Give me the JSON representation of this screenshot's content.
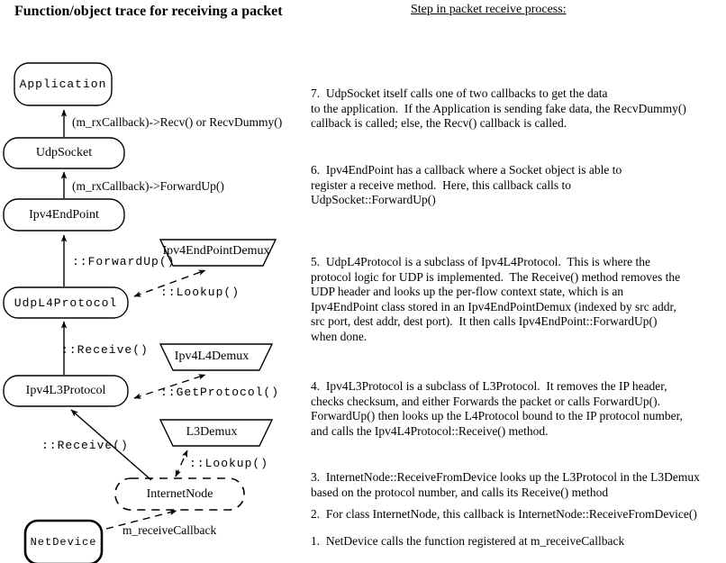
{
  "title": "Function/object trace for receiving a packet",
  "right_heading": "Step in packet receive process:",
  "nodes": {
    "application": "Application",
    "udp_socket": "UdpSocket",
    "ipv4_endpoint": "Ipv4EndPoint",
    "udp_l4_protocol": "UdpL4Protocol",
    "ipv4_l3_protocol": "Ipv4L3Protocol",
    "ipv4_endpoint_demux": "Ipv4EndPointDemux",
    "ipv4_l4_demux": "Ipv4L4Demux",
    "l3_demux": "L3Demux",
    "internet_node": "InternetNode",
    "net_device": "NetDevice"
  },
  "edges": {
    "recv_callback": "(m_rxCallback)->Recv() or RecvDummy()",
    "forwardup_callback": "(m_rxCallback)->ForwardUp()",
    "forwardup": "::ForwardUp()",
    "lookup_endpoint": "::Lookup()",
    "receive_udp": "::Receive()",
    "get_protocol": "::GetProtocol()",
    "receive_l3": "::Receive()",
    "lookup_l3demux": "::Lookup()",
    "m_receive_callback": "m_receiveCallback"
  },
  "steps": [
    {
      "id": "step-7",
      "lines": "7.  UdpSocket itself calls one of two callbacks to get the data\nto the application.  If the Application is sending fake data, the RecvDummy()\ncallback is called; else, the Recv() callback is called."
    },
    {
      "id": "step-6",
      "lines": "6.  Ipv4EndPoint has a callback where a Socket object is able to\nregister a receive method.  Here, this callback calls to\nUdpSocket::ForwardUp()"
    },
    {
      "id": "step-5",
      "lines": "5.  UdpL4Protocol is a subclass of Ipv4L4Protocol.  This is where the\nprotocol logic for UDP is implemented.  The Receive() method removes the\nUDP header and looks up the per-flow context state, which is an\nIpv4EndPoint class stored in an Ipv4EndPointDemux (indexed by src addr,\nsrc port, dest addr, dest port).  It then calls Ipv4EndPoint::ForwardUp()\nwhen done."
    },
    {
      "id": "step-4",
      "lines": "4.  Ipv4L3Protocol is a subclass of L3Protocol.  It removes the IP header,\nchecks checksum, and either Forwards the packet or calls ForwardUp().\nForwardUp() then looks up the L4Protocol bound to the IP protocol number,\nand calls the Ipv4L4Protocol::Receive() method."
    },
    {
      "id": "step-3",
      "lines": "3.  InternetNode::ReceiveFromDevice looks up the L3Protocol in the L3Demux\nbased on the protocol number, and calls its Receive() method"
    },
    {
      "id": "step-2",
      "lines": "2.  For class InternetNode, this callback is InternetNode::ReceiveFromDevice()"
    },
    {
      "id": "step-1",
      "lines": "1.  NetDevice calls the function registered at m_receiveCallback"
    }
  ],
  "colors": {
    "stroke": "#000000",
    "background": "#ffffff"
  }
}
